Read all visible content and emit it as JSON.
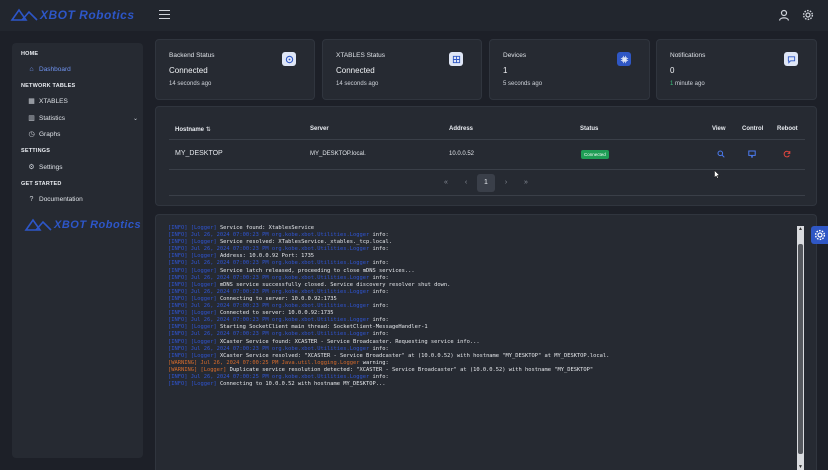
{
  "app": {
    "logo_text": "XBOT Robotics"
  },
  "sidebar": {
    "sections": [
      {
        "heading": "HOME",
        "items": [
          {
            "label": "Dashboard",
            "icon": "home-icon",
            "active": true
          }
        ]
      },
      {
        "heading": "NETWORK TABLES",
        "items": [
          {
            "label": "XTABLES",
            "icon": "table-icon"
          },
          {
            "label": "Statistics",
            "icon": "chart-icon",
            "expandable": true
          },
          {
            "label": "Graphs",
            "icon": "graph-icon"
          }
        ]
      },
      {
        "heading": "SETTINGS",
        "items": [
          {
            "label": "Settings",
            "icon": "gear-icon"
          }
        ]
      },
      {
        "heading": "GET STARTED",
        "items": [
          {
            "label": "Documentation",
            "icon": "question-icon"
          }
        ]
      }
    ]
  },
  "cards": [
    {
      "title": "Backend Status",
      "value": "Connected",
      "sub": "14 seconds ago",
      "icon": "backend-icon"
    },
    {
      "title": "XTABLES Status",
      "value": "Connected",
      "sub": "14 seconds ago",
      "icon": "table-icon"
    },
    {
      "title": "Devices",
      "value": "1",
      "sub": "5 seconds ago",
      "icon": "chip-icon"
    },
    {
      "title": "Notifications",
      "value": "0",
      "sub_highlight": "1",
      "sub_rest": " minute ago",
      "icon": "message-icon"
    }
  ],
  "table": {
    "headers": {
      "hostname": "Hostname",
      "server": "Server",
      "address": "Address",
      "status": "Status",
      "view": "View",
      "control": "Control",
      "reboot": "Reboot"
    },
    "rows": [
      {
        "hostname": "MY_DESKTOP",
        "server": "MY_DESKTOP.local.",
        "address": "10.0.0.52",
        "status": "Connected"
      }
    ],
    "pagination": {
      "current_page": "1"
    }
  },
  "log": [
    [
      {
        "c": "blue",
        "t": "[INFO] [Logger] "
      },
      {
        "c": "white",
        "t": "Service found: XtablesService"
      }
    ],
    [
      {
        "c": "blue",
        "t": "[INFO] Jul 26, 2024 07:00:23 PM org.kobe.xbot.Utilities.Logger "
      },
      {
        "c": "white",
        "t": "info:"
      }
    ],
    [
      {
        "c": "blue",
        "t": "[INFO] [Logger] "
      },
      {
        "c": "white",
        "t": "Service resolved: XTablesService._xtables._tcp.local."
      }
    ],
    [
      {
        "c": "blue",
        "t": "[INFO] Jul 26, 2024 07:00:23 PM org.kobe.xbot.Utilities.Logger "
      },
      {
        "c": "white",
        "t": "info:"
      }
    ],
    [
      {
        "c": "blue",
        "t": "[INFO] [Logger] "
      },
      {
        "c": "white",
        "t": "Address: 10.0.0.92 Port: 1735"
      }
    ],
    [
      {
        "c": "blue",
        "t": "[INFO] Jul 26, 2024 07:00:23 PM org.kobe.xbot.Utilities.Logger "
      },
      {
        "c": "white",
        "t": "info:"
      }
    ],
    [
      {
        "c": "blue",
        "t": "[INFO] [Logger] "
      },
      {
        "c": "white",
        "t": "Service latch released, proceeding to close mDNS services..."
      }
    ],
    [
      {
        "c": "blue",
        "t": "[INFO] Jul 26, 2024 07:00:23 PM org.kobe.xbot.Utilities.Logger "
      },
      {
        "c": "white",
        "t": "info:"
      }
    ],
    [
      {
        "c": "blue",
        "t": "[INFO] [Logger] "
      },
      {
        "c": "white",
        "t": "mDNS service successfully closed. Service discovery resolver shut down."
      }
    ],
    [
      {
        "c": "blue",
        "t": "[INFO] Jul 26, 2024 07:00:23 PM org.kobe.xbot.Utilities.Logger "
      },
      {
        "c": "white",
        "t": "info:"
      }
    ],
    [
      {
        "c": "blue",
        "t": "[INFO] [Logger] "
      },
      {
        "c": "white",
        "t": "Connecting to server: 10.0.0.92:1735"
      }
    ],
    [
      {
        "c": "blue",
        "t": "[INFO] Jul 26, 2024 07:00:23 PM org.kobe.xbot.Utilities.Logger "
      },
      {
        "c": "white",
        "t": "info:"
      }
    ],
    [
      {
        "c": "blue",
        "t": "[INFO] [Logger] "
      },
      {
        "c": "white",
        "t": "Connected to server: 10.0.0.92:1735"
      }
    ],
    [
      {
        "c": "blue",
        "t": "[INFO] Jul 26, 2024 07:00:23 PM org.kobe.xbot.Utilities.Logger "
      },
      {
        "c": "white",
        "t": "info:"
      }
    ],
    [
      {
        "c": "blue",
        "t": "[INFO] [Logger] "
      },
      {
        "c": "white",
        "t": "Starting SocketClient main thread: SocketClient-MessageHandler-1"
      }
    ],
    [
      {
        "c": "blue",
        "t": "[INFO] Jul 26, 2024 07:00:23 PM org.kobe.xbot.Utilities.Logger "
      },
      {
        "c": "white",
        "t": "info:"
      }
    ],
    [
      {
        "c": "blue",
        "t": "[INFO] [Logger] "
      },
      {
        "c": "white",
        "t": "XCaster Service found: XCASTER - Service Broadcaster. Requesting service info..."
      }
    ],
    [
      {
        "c": "blue",
        "t": "[INFO] Jul 26, 2024 07:00:23 PM org.kobe.xbot.Utilities.Logger "
      },
      {
        "c": "white",
        "t": "info:"
      }
    ],
    [
      {
        "c": "blue",
        "t": "[INFO] [Logger] "
      },
      {
        "c": "white",
        "t": "XCaster Service resolved: \"XCASTER - Service Broadcaster\" at (10.0.0.52) with hostname \"MY_DESKTOP\" at MY_DESKTOP.local."
      }
    ],
    [
      {
        "c": "warn",
        "t": "[WARNING] Jul 26, 2024 07:00:25 PM Java.util.logging.Logger "
      },
      {
        "c": "white",
        "t": "warning:"
      }
    ],
    [
      {
        "c": "warn",
        "t": "[WARNING] [Logger] "
      },
      {
        "c": "white",
        "t": "Duplicate service resolution detected: \"XCASTER - Service Broadcaster\" at (10.0.0.52) with hostname \"MY_DESKTOP\""
      }
    ],
    [
      {
        "c": "blue",
        "t": "[INFO] Jul 26, 2024 07:00:25 PM org.kobe.xbot.Utilities.Logger "
      },
      {
        "c": "white",
        "t": "info:"
      }
    ],
    [
      {
        "c": "blue",
        "t": "[INFO] [Logger] "
      },
      {
        "c": "white",
        "t": "Connecting to 10.0.0.52 with hostname MY_DESKTOP..."
      }
    ]
  ],
  "colors": {
    "accent": "#2f57c5",
    "bg": "#1d2028",
    "panel": "#262a32",
    "status_ok": "#1f9d55",
    "log_info": "#2f55d4",
    "log_warn": "#d76c2c"
  }
}
